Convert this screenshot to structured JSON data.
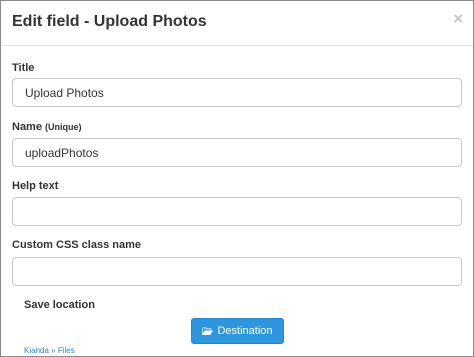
{
  "header": {
    "title": "Edit field - Upload Photos",
    "close_glyph": "×"
  },
  "fields": {
    "title": {
      "label": "Title",
      "value": "Upload Photos"
    },
    "name": {
      "label": "Name",
      "hint": "(Unique)",
      "value": "uploadPhotos"
    },
    "help_text": {
      "label": "Help text",
      "value": ""
    },
    "css_class": {
      "label": "Custom CSS class name",
      "value": ""
    }
  },
  "save_location": {
    "label": "Save location",
    "button_label": "Destination",
    "breadcrumb": {
      "root": "Kianda",
      "separator": "»",
      "current": "Files"
    }
  },
  "colors": {
    "accent": "#2d96e0",
    "link": "#2d86d2"
  }
}
